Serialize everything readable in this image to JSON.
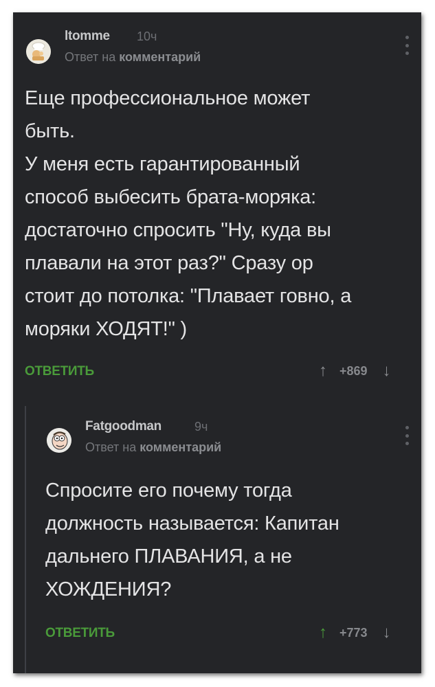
{
  "comments": [
    {
      "username": "ltomme",
      "time": "10ч",
      "reply_prefix": "Ответ на",
      "reply_target": "комментарий",
      "text_lines": [
        "Еще профессиональное может",
        "быть.",
        "У меня есть гарантированный",
        "способ выбесить брата-моряка:",
        "достаточно спросить \"Ну, куда вы",
        "плавали на этот раз?\" Сразу ор",
        "стоит до потолка: \"Плавает говно, а",
        "моряки ХОДЯТ!\" )"
      ],
      "reply_button": "ОТВЕТИТЬ",
      "score": "+869",
      "upvote_color": "#8a8c90",
      "avatar_icon": "chef-avatar-icon"
    },
    {
      "username": "Fatgoodman",
      "time": "9ч",
      "reply_prefix": "Ответ на",
      "reply_target": "комментарий",
      "text_lines": [
        "Спросите его почему тогда",
        "должность называется: Капитан",
        "дальнего ПЛАВАНИЯ, а не",
        "ХОЖДЕНИЯ?"
      ],
      "reply_button": "ОТВЕТИТЬ",
      "score": "+773",
      "upvote_color": "#4a9b3a",
      "avatar_icon": "peter-griffin-avatar-icon"
    }
  ],
  "icons": {
    "upvote": "↑",
    "downvote": "↓"
  },
  "colors": {
    "background": "#242528",
    "accent_green": "#4a9b3a",
    "text": "#e4e4e5"
  }
}
